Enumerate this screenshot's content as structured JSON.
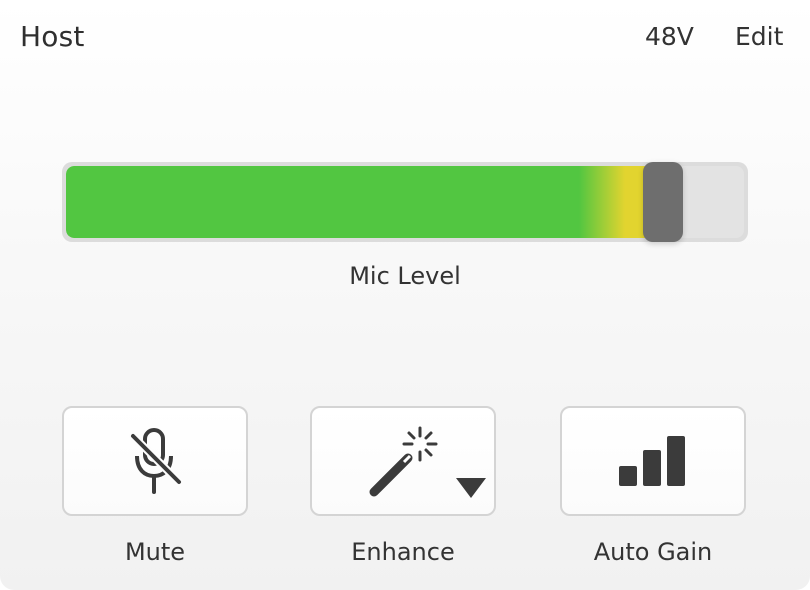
{
  "header": {
    "title": "Host",
    "phantom_power_label": "48V",
    "edit_label": "Edit"
  },
  "meter": {
    "label": "Mic Level",
    "level": 0.86,
    "gain": 0.9,
    "colors": {
      "green": "#52c641",
      "yellow": "#e2d42f",
      "thumb": "#6e6e6e",
      "track": "#dcdcdc"
    }
  },
  "buttons": [
    {
      "label": "Mute",
      "icon": "microphone-muted-icon"
    },
    {
      "label": "Enhance",
      "icon": "magic-wand-icon",
      "has_dropdown": true
    },
    {
      "label": "Auto Gain",
      "icon": "bars-signal-icon"
    }
  ],
  "colors": {
    "icon": "#3b3b3b",
    "text": "#333333"
  }
}
